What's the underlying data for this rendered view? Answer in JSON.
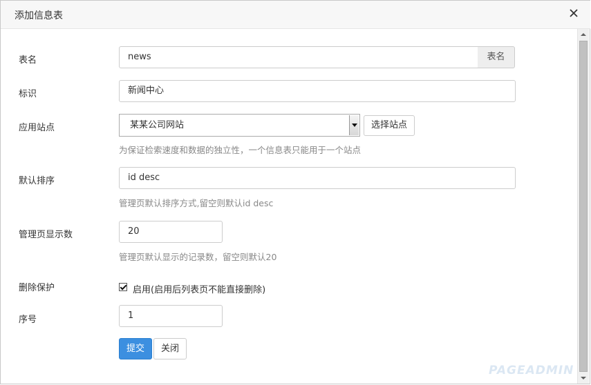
{
  "dialog": {
    "title": "添加信息表"
  },
  "form": {
    "table_name": {
      "label": "表名",
      "value": "news",
      "addon": "表名"
    },
    "identifier": {
      "label": "标识",
      "value": "新闻中心"
    },
    "site": {
      "label": "应用站点",
      "selected": "某某公司网站",
      "button": "选择站点",
      "help": "为保证检索速度和数据的独立性，一个信息表只能用于一个站点"
    },
    "default_sort": {
      "label": "默认排序",
      "value": "id desc",
      "help": "管理页默认排序方式,留空则默认id desc"
    },
    "page_size": {
      "label": "管理页显示数",
      "value": "20",
      "help": "管理页默认显示的记录数，留空则默认20"
    },
    "delete_protect": {
      "label": "删除保护",
      "checked": true,
      "option": "启用(启用后列表页不能直接删除)"
    },
    "order": {
      "label": "序号",
      "value": "1"
    }
  },
  "actions": {
    "submit": "提交",
    "close": "关闭"
  },
  "watermark": "PAGEADMIN",
  "colors": {
    "primary": "#3c8fe0",
    "title_bar": "#f7f7f7",
    "help_text": "#888888"
  }
}
